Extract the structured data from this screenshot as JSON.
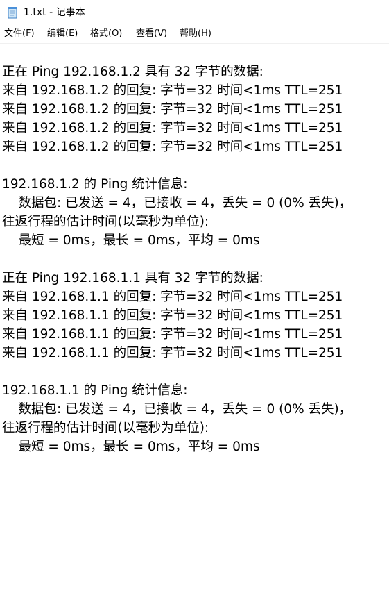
{
  "window": {
    "title": "1.txt - 记事本",
    "icon": "notepad-icon"
  },
  "menu": {
    "file": "文件(F)",
    "edit": "编辑(E)",
    "format": "格式(O)",
    "view": "查看(V)",
    "help": "帮助(H)"
  },
  "document": {
    "lines": [
      "正在 Ping 192.168.1.2 具有 32 字节的数据:",
      "来自 192.168.1.2 的回复: 字节=32 时间<1ms TTL=251",
      "来自 192.168.1.2 的回复: 字节=32 时间<1ms TTL=251",
      "来自 192.168.1.2 的回复: 字节=32 时间<1ms TTL=251",
      "来自 192.168.1.2 的回复: 字节=32 时间<1ms TTL=251",
      "",
      "192.168.1.2 的 Ping 统计信息:",
      "    数据包: 已发送 = 4，已接收 = 4，丢失 = 0 (0% 丢失)，",
      "往返行程的估计时间(以毫秒为单位):",
      "    最短 = 0ms，最长 = 0ms，平均 = 0ms",
      "",
      "正在 Ping 192.168.1.1 具有 32 字节的数据:",
      "来自 192.168.1.1 的回复: 字节=32 时间<1ms TTL=251",
      "来自 192.168.1.1 的回复: 字节=32 时间<1ms TTL=251",
      "来自 192.168.1.1 的回复: 字节=32 时间<1ms TTL=251",
      "来自 192.168.1.1 的回复: 字节=32 时间<1ms TTL=251",
      "",
      "192.168.1.1 的 Ping 统计信息:",
      "    数据包: 已发送 = 4，已接收 = 4，丢失 = 0 (0% 丢失)，",
      "往返行程的估计时间(以毫秒为单位):",
      "    最短 = 0ms，最长 = 0ms，平均 = 0ms"
    ]
  }
}
